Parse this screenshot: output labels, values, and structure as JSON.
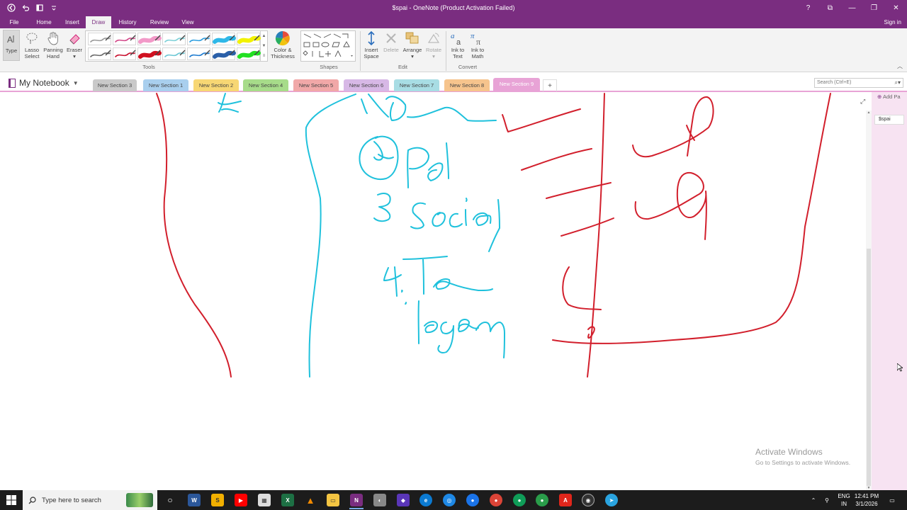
{
  "window": {
    "title": "$spai - OneNote (Product Activation Failed)",
    "controls": [
      "?",
      "⧉",
      "—",
      "❐",
      "✕"
    ]
  },
  "ribbon": {
    "tabs": [
      "File",
      "Home",
      "Insert",
      "Draw",
      "History",
      "Review",
      "View"
    ],
    "active_tab": "Draw",
    "sign_in": "Sign in",
    "tools": {
      "type": "Type",
      "lasso_1": "Lasso",
      "lasso_2": "Select",
      "panning_1": "Panning",
      "panning_2": "Hand",
      "eraser": "Eraser",
      "color_1": "Color &",
      "color_2": "Thickness",
      "insert_space_1": "Insert",
      "insert_space_2": "Space",
      "delete": "Delete",
      "arrange": "Arrange",
      "rotate": "Rotate",
      "ink_text_1": "Ink to",
      "ink_text_2": "Text",
      "ink_math_1": "Ink to",
      "ink_math_2": "Math"
    },
    "groups": {
      "tools": "Tools",
      "shapes": "Shapes",
      "edit": "Edit",
      "convert": "Convert"
    },
    "pens": [
      "#9a9a9a",
      "#d24a8a",
      "#f299c8",
      "#7fd1d8",
      "#2f9fe0",
      "#2fb8e8",
      "#f2f200",
      "#6a6a6a",
      "#c8102e",
      "#d01020",
      "#6cc7d4",
      "#1e7bd0",
      "#2a5fa8",
      "#22e022"
    ]
  },
  "notebook": {
    "name": "My Notebook",
    "sections": [
      {
        "label": "New Section 3",
        "color": "#c9c9c9"
      },
      {
        "label": "New Section 1",
        "color": "#a9cfee"
      },
      {
        "label": "New Section 2",
        "color": "#f7d774"
      },
      {
        "label": "New Section 4",
        "color": "#a7dc8a"
      },
      {
        "label": "New Section 5",
        "color": "#f1a8a8"
      },
      {
        "label": "New Section 6",
        "color": "#d7b8e6"
      },
      {
        "label": "New Section 7",
        "color": "#a8dde4"
      },
      {
        "label": "New Section 8",
        "color": "#f6c48d"
      },
      {
        "label": "New Section 9",
        "color": "#e8a3d6"
      }
    ],
    "active_section": "New Section 9",
    "add_section": "+",
    "search_placeholder": "Search (Ctrl+E)"
  },
  "pages": {
    "add_page": "Add Pa",
    "items": [
      "$spai"
    ]
  },
  "watermark": {
    "line1": "Activate Windows",
    "line2": "Go to Settings to activate Windows."
  },
  "taskbar": {
    "search_placeholder": "Type here to search",
    "lang_1": "ENG",
    "lang_2": "IN",
    "time": "12:41 PM",
    "date": "3/1/2026"
  },
  "colors": {
    "brand": "#7a2d80",
    "ink_red": "#d21f2c",
    "ink_cyan": "#1fc1dc"
  }
}
